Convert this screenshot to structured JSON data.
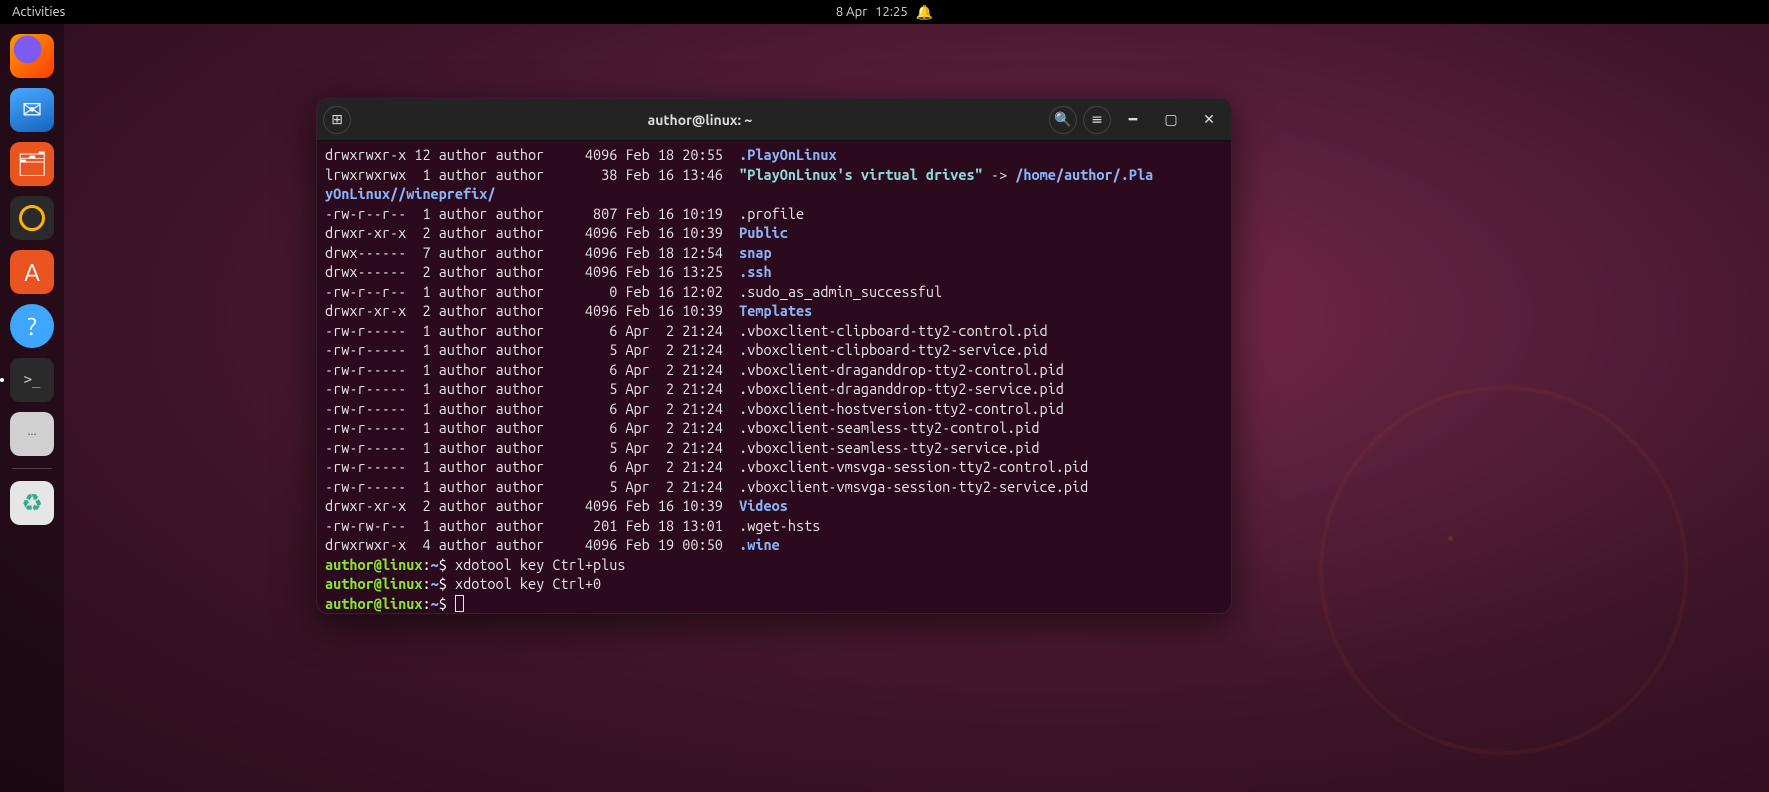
{
  "topbar": {
    "activities": "Activities",
    "date": "8 Apr",
    "time": "12:25"
  },
  "dock": {
    "items": [
      {
        "name": "firefox",
        "label": "Firefox"
      },
      {
        "name": "thunderbird",
        "label": "Thunderbird"
      },
      {
        "name": "files",
        "label": "Files"
      },
      {
        "name": "rhythmbox",
        "label": "Rhythmbox"
      },
      {
        "name": "software",
        "label": "Ubuntu Software"
      },
      {
        "name": "help",
        "label": "Help"
      },
      {
        "name": "terminal",
        "label": "Terminal"
      },
      {
        "name": "texteditor",
        "label": "Text Editor"
      }
    ],
    "trash_label": "Trash"
  },
  "window": {
    "title": "author@linux: ~"
  },
  "prompt": {
    "user": "author",
    "host": "linux",
    "path": "~",
    "sep1": "@",
    "sep2": ":",
    "sigil": "$"
  },
  "history": [
    "xdotool key Ctrl+plus",
    "xdotool key Ctrl+0"
  ],
  "symlink": {
    "perms": "lrwxrwxrwx",
    "links": "1",
    "user": "author",
    "group": "author",
    "size": "38",
    "date": "Feb 16 13:46",
    "name": "\"PlayOnLinux's virtual drives\"",
    "arrow": "->",
    "target": "/home/author/.Pla",
    "wrap": "yOnLinux//wineprefix/"
  },
  "listing": [
    {
      "perms": "drwxrwxr-x",
      "links": "12",
      "user": "author",
      "group": "author",
      "size": "4096",
      "date": "Feb 18 20:55",
      "name": ".PlayOnLinux",
      "type": "dir"
    },
    {
      "perms": "-rw-r--r--",
      "links": "1",
      "user": "author",
      "group": "author",
      "size": "807",
      "date": "Feb 16 10:19",
      "name": ".profile",
      "type": "file"
    },
    {
      "perms": "drwxr-xr-x",
      "links": "2",
      "user": "author",
      "group": "author",
      "size": "4096",
      "date": "Feb 16 10:39",
      "name": "Public",
      "type": "dir"
    },
    {
      "perms": "drwx------",
      "links": "7",
      "user": "author",
      "group": "author",
      "size": "4096",
      "date": "Feb 18 12:54",
      "name": "snap",
      "type": "dir"
    },
    {
      "perms": "drwx------",
      "links": "2",
      "user": "author",
      "group": "author",
      "size": "4096",
      "date": "Feb 16 13:25",
      "name": ".ssh",
      "type": "dir"
    },
    {
      "perms": "-rw-r--r--",
      "links": "1",
      "user": "author",
      "group": "author",
      "size": "0",
      "date": "Feb 16 12:02",
      "name": ".sudo_as_admin_successful",
      "type": "file"
    },
    {
      "perms": "drwxr-xr-x",
      "links": "2",
      "user": "author",
      "group": "author",
      "size": "4096",
      "date": "Feb 16 10:39",
      "name": "Templates",
      "type": "dir"
    },
    {
      "perms": "-rw-r-----",
      "links": "1",
      "user": "author",
      "group": "author",
      "size": "6",
      "date": "Apr  2 21:24",
      "name": ".vboxclient-clipboard-tty2-control.pid",
      "type": "file"
    },
    {
      "perms": "-rw-r-----",
      "links": "1",
      "user": "author",
      "group": "author",
      "size": "5",
      "date": "Apr  2 21:24",
      "name": ".vboxclient-clipboard-tty2-service.pid",
      "type": "file"
    },
    {
      "perms": "-rw-r-----",
      "links": "1",
      "user": "author",
      "group": "author",
      "size": "6",
      "date": "Apr  2 21:24",
      "name": ".vboxclient-draganddrop-tty2-control.pid",
      "type": "file"
    },
    {
      "perms": "-rw-r-----",
      "links": "1",
      "user": "author",
      "group": "author",
      "size": "5",
      "date": "Apr  2 21:24",
      "name": ".vboxclient-draganddrop-tty2-service.pid",
      "type": "file"
    },
    {
      "perms": "-rw-r-----",
      "links": "1",
      "user": "author",
      "group": "author",
      "size": "6",
      "date": "Apr  2 21:24",
      "name": ".vboxclient-hostversion-tty2-control.pid",
      "type": "file"
    },
    {
      "perms": "-rw-r-----",
      "links": "1",
      "user": "author",
      "group": "author",
      "size": "6",
      "date": "Apr  2 21:24",
      "name": ".vboxclient-seamless-tty2-control.pid",
      "type": "file"
    },
    {
      "perms": "-rw-r-----",
      "links": "1",
      "user": "author",
      "group": "author",
      "size": "5",
      "date": "Apr  2 21:24",
      "name": ".vboxclient-seamless-tty2-service.pid",
      "type": "file"
    },
    {
      "perms": "-rw-r-----",
      "links": "1",
      "user": "author",
      "group": "author",
      "size": "6",
      "date": "Apr  2 21:24",
      "name": ".vboxclient-vmsvga-session-tty2-control.pid",
      "type": "file"
    },
    {
      "perms": "-rw-r-----",
      "links": "1",
      "user": "author",
      "group": "author",
      "size": "5",
      "date": "Apr  2 21:24",
      "name": ".vboxclient-vmsvga-session-tty2-service.pid",
      "type": "file"
    },
    {
      "perms": "drwxr-xr-x",
      "links": "2",
      "user": "author",
      "group": "author",
      "size": "4096",
      "date": "Feb 16 10:39",
      "name": "Videos",
      "type": "dir"
    },
    {
      "perms": "-rw-rw-r--",
      "links": "1",
      "user": "author",
      "group": "author",
      "size": "201",
      "date": "Feb 18 13:01",
      "name": ".wget-hsts",
      "type": "file"
    },
    {
      "perms": "drwxrwxr-x",
      "links": "4",
      "user": "author",
      "group": "author",
      "size": "4096",
      "date": "Feb 19 00:50",
      "name": ".wine",
      "type": "dir"
    }
  ]
}
